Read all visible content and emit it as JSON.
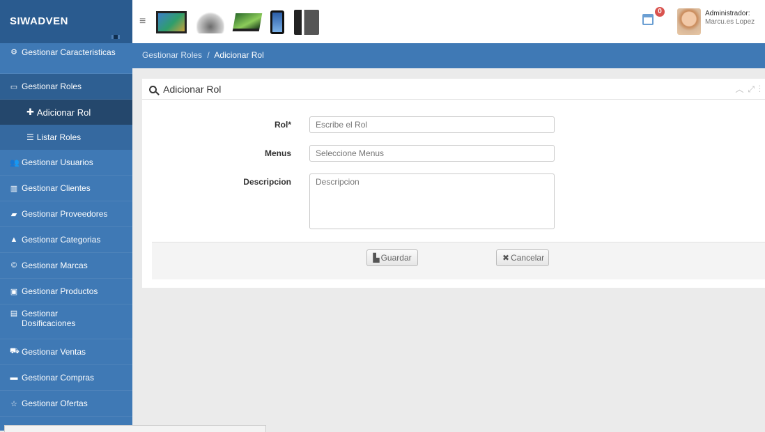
{
  "brand": {
    "name": "SIWADVEN"
  },
  "header": {
    "banner_items": [
      "tablet",
      "mouse",
      "laptop",
      "phone",
      "accessories"
    ],
    "notification_count": "0",
    "user": {
      "role": "Administrador:",
      "name": "Marcu.es Lopez"
    }
  },
  "sidebar": {
    "items": [
      {
        "label": "Gestionar Caracteristicas",
        "icon": "cogs-icon"
      },
      {
        "label": "Gestionar Roles",
        "icon": "window-icon"
      },
      {
        "label": "Gestionar Usuarios",
        "icon": "users-icon"
      },
      {
        "label": "Gestionar Clientes",
        "icon": "building-icon"
      },
      {
        "label": "Gestionar Proveedores",
        "icon": "truck-icon"
      },
      {
        "label": "Gestionar Categorias",
        "icon": "sitemap-icon"
      },
      {
        "label": "Gestionar Marcas",
        "icon": "copyright-icon"
      },
      {
        "label": "Gestionar Productos",
        "icon": "box-icon"
      },
      {
        "label": "Gestionar Dosificaciones",
        "icon": "list-icon"
      },
      {
        "label": "Gestionar Ventas",
        "icon": "cart-icon"
      },
      {
        "label": "Gestionar Compras",
        "icon": "credit-card-icon"
      },
      {
        "label": "Gestionar Ofertas",
        "icon": "star-icon"
      }
    ],
    "sub_items": [
      {
        "label": "Adicionar Rol",
        "icon": "plus-icon"
      },
      {
        "label": "Listar Roles",
        "icon": "list-icon"
      }
    ]
  },
  "breadcrumb": {
    "parent": "Gestionar Roles",
    "separator": "/",
    "current": "Adicionar Rol"
  },
  "panel": {
    "title": "Adicionar Rol",
    "fields": {
      "rol": {
        "label": "Rol*",
        "placeholder": "Escribe el Rol",
        "value": ""
      },
      "menus": {
        "label": "Menus",
        "placeholder": "Seleccione Menus",
        "value": ""
      },
      "descripcion": {
        "label": "Descripcion",
        "placeholder": "Descripcion",
        "value": ""
      }
    },
    "buttons": {
      "save": "Guardar",
      "cancel": "Cancelar"
    }
  },
  "colors": {
    "sidebar": "#3f79b5",
    "brand": "#2a5b8f",
    "active": "#24476c"
  }
}
